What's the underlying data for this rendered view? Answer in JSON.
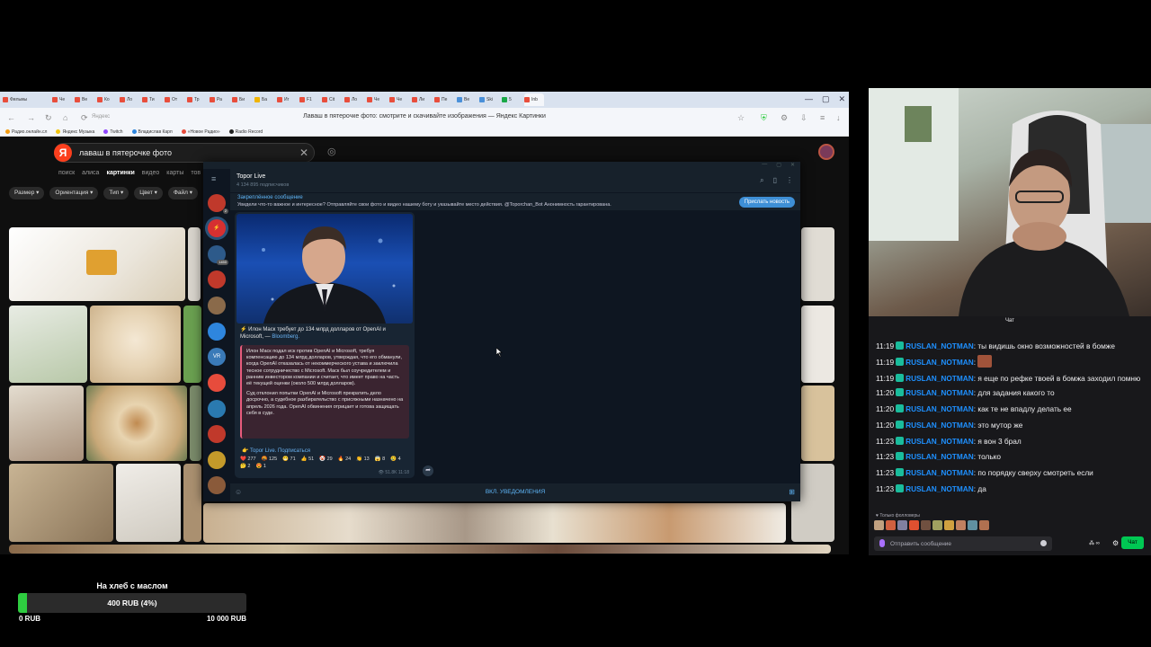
{
  "browser": {
    "tabs": [
      {
        "label": "Фильмы",
        "color": "#e84e3c"
      },
      {
        "label": "Че",
        "color": "#e84e3c"
      },
      {
        "label": "Ве",
        "color": "#e84e3c"
      },
      {
        "label": "Ко",
        "color": "#e84e3c"
      },
      {
        "label": "Ло",
        "color": "#e84e3c"
      },
      {
        "label": "Ти",
        "color": "#e84e3c"
      },
      {
        "label": "От",
        "color": "#e84e3c"
      },
      {
        "label": "Тр",
        "color": "#e84e3c"
      },
      {
        "label": "Ра",
        "color": "#e84e3c"
      },
      {
        "label": "Би",
        "color": "#e84e3c"
      },
      {
        "label": "Ба",
        "color": "#f0b400"
      },
      {
        "label": "Иг",
        "color": "#e84e3c"
      },
      {
        "label": "F1",
        "color": "#e84e3c"
      },
      {
        "label": "Cit",
        "color": "#e84e3c"
      },
      {
        "label": "Ло",
        "color": "#e84e3c"
      },
      {
        "label": "Че",
        "color": "#e84e3c"
      },
      {
        "label": "Че",
        "color": "#e84e3c"
      },
      {
        "label": "Ли",
        "color": "#e84e3c"
      },
      {
        "label": "Пе",
        "color": "#e84e3c"
      },
      {
        "label": "Ве",
        "color": "#4a90d9"
      },
      {
        "label": "Ski",
        "color": "#4a90d9"
      },
      {
        "label": "5",
        "color": "#1aa848"
      },
      {
        "label": "Inb",
        "color": "#e84e3c"
      }
    ],
    "address": "Яндекс",
    "page_title": "Лаваш в пятерочке фото: смотрите и скачивайте изображения — Яндекс Картинки",
    "bookmarks": [
      {
        "label": "Радио.онлайн.сл",
        "color": "#f39c12"
      },
      {
        "label": "Яндекс Музыка",
        "color": "#f1c40f"
      },
      {
        "label": "Twitch",
        "color": "#9146ff"
      },
      {
        "label": "Владислав Карп",
        "color": "#2e86de"
      },
      {
        "label": "«Новое Радио»",
        "color": "#e74c3c"
      },
      {
        "label": "Radio Record",
        "color": "#222222"
      }
    ]
  },
  "yandex": {
    "logo": "Я",
    "query": "лаваш в пятерочке фото",
    "tabs": [
      "поиск",
      "алиса",
      "картинки",
      "видео",
      "карты",
      "тов"
    ],
    "active_tab": "картинки",
    "filters": [
      "Размер ▾",
      "Ориентация ▾",
      "Тип ▾",
      "Цвет ▾",
      "Файл ▾"
    ]
  },
  "telegram": {
    "channel_name": "Topor Live",
    "subscribers": "4 134 895 подписчиков",
    "pinned_title": "Закреплённое сообщение",
    "pinned_text": "Увидели что-то важное и интересное? Отправляйте свои фото и видео нашему боту и указывайте место действия. @Toporchan_Bot Анонимность гарантирована.",
    "pinned_button": "Прислать новость",
    "caption_text": "⚡️ Илон Маск требует до 134 млрд долларов от OpenAI и Microsoft, — ",
    "caption_source": "Bloomberg.",
    "quote_p1": "Илон Маск подал иск против OpenAI и Microsoft, требуя компенсацию до 134 млрд долларов, утверждая, что его обманули, когда OpenAI отказалась от некоммерческого устава и заключила тесное сотрудничество с Microsoft. Маск был соучредителем и ранним инвестором компании и считает, что имеет право на часть её текущей оценки (около 500 млрд долларов).",
    "quote_p2": "Суд отклонил попытки OpenAI и Microsoft прекратить дело досрочно, а судебное разбирательство с присяжными назначено на апрель 2026 года. OpenAI обвинения отрицает и готова защищать себя в суде.",
    "subscribe_link": "👉 Topor Live. Подписаться",
    "reactions": [
      {
        "emoji": "❤️",
        "count": "277"
      },
      {
        "emoji": "🤬",
        "count": "125"
      },
      {
        "emoji": "😁",
        "count": "71"
      },
      {
        "emoji": "👍",
        "count": "51"
      },
      {
        "emoji": "🤡",
        "count": "29"
      },
      {
        "emoji": "🔥",
        "count": "24"
      },
      {
        "emoji": "👏",
        "count": "13"
      },
      {
        "emoji": "😱",
        "count": "8"
      },
      {
        "emoji": "😢",
        "count": "4"
      },
      {
        "emoji": "🤔",
        "count": "2"
      },
      {
        "emoji": "😍",
        "count": "1"
      }
    ],
    "views": "👁 51.8K",
    "time": "11:18",
    "bottom_action": "ВКЛ. УВЕДОМЛЕНИЯ",
    "sidebar_badge_1": "2",
    "sidebar_badge_2": "1450",
    "sidebar_vr": "VR"
  },
  "chat": {
    "title": "Чат",
    "messages": [
      {
        "time": "11:19",
        "user": "RUSLAN_NOTMAN",
        "text": ": ты видишь окно возможностей в бомже"
      },
      {
        "time": "11:19",
        "user": "RUSLAN_NOTMAN",
        "text": ":",
        "emote": "emote"
      },
      {
        "time": "11:19",
        "user": "RUSLAN_NOTMAN",
        "text": ": я еще по рефке твоей в бомжа заходил помню"
      },
      {
        "time": "11:20",
        "user": "RUSLAN_NOTMAN",
        "text": ": для задания какого то"
      },
      {
        "time": "11:20",
        "user": "RUSLAN_NOTMAN",
        "text": ": как те не впадлу делать ее"
      },
      {
        "time": "11:20",
        "user": "RUSLAN_NOTMAN",
        "text": ": это мутор же"
      },
      {
        "time": "11:23",
        "user": "RUSLAN_NOTMAN",
        "text": ": я вон 3 брал"
      },
      {
        "time": "11:23",
        "user": "RUSLAN_NOTMAN",
        "text": ": только"
      },
      {
        "time": "11:23",
        "user": "RUSLAN_NOTMAN",
        "text": ": по порядку сверху смотреть если"
      },
      {
        "time": "11:23",
        "user": "RUSLAN_NOTMAN",
        "text": ": да"
      }
    ],
    "followers_only": "♥ Только фолловеры",
    "input_placeholder": "Отправить сообщение",
    "points": "∞",
    "send_label": "Чат"
  },
  "goal": {
    "title": "На хлеб с маслом",
    "progress_text": "400 RUB (4%)",
    "progress_fraction": 0.04,
    "min_label": "0 RUB",
    "max_label": "10 000 RUB"
  }
}
